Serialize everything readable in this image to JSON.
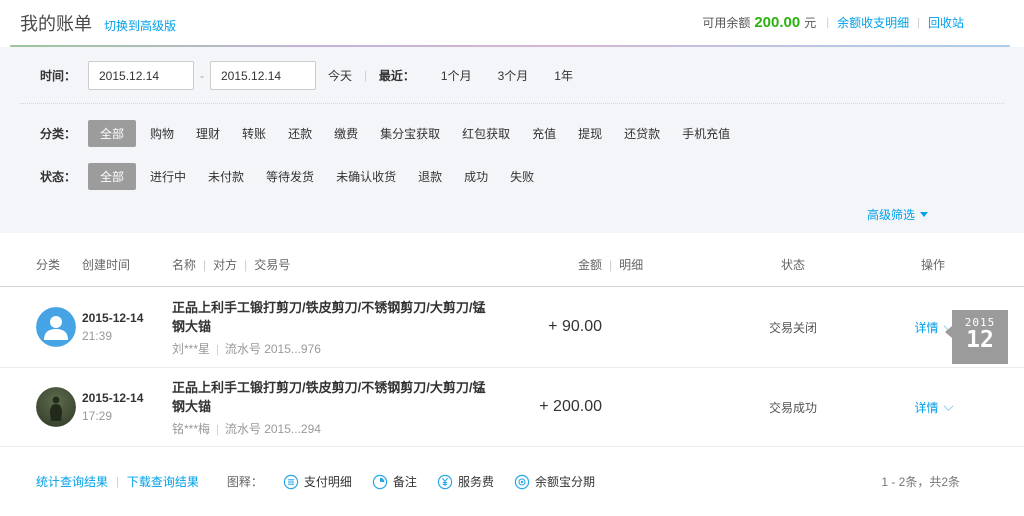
{
  "separators": {
    "pipe": "|",
    "dash": "-"
  },
  "colors": {
    "accent_blue": "#00a0e9",
    "balance_green": "#2bb20e",
    "selected_chip_bg": "#9c9c9c",
    "badge_bg": "#9b9b9b",
    "panel_bg": "#f4f5f9"
  },
  "header": {
    "title": "我的账单",
    "switch_link": "切换到高级版",
    "balance_label": "可用余额",
    "balance_value": "200.00",
    "balance_unit": "元",
    "links": [
      "余额收支明细",
      "回收站"
    ]
  },
  "filters": {
    "time": {
      "label": "时间：",
      "start": "2015.12.14",
      "end": "2015.12.14",
      "today": "今天",
      "recent_label": "最近：",
      "ranges": [
        "1个月",
        "3个月",
        "1年"
      ]
    },
    "category": {
      "label": "分类：",
      "options": [
        "全部",
        "购物",
        "理财",
        "转账",
        "还款",
        "缴费",
        "集分宝获取",
        "红包获取",
        "充值",
        "提现",
        "还贷款",
        "手机充值"
      ],
      "selected": "全部"
    },
    "status": {
      "label": "状态：",
      "options": [
        "全部",
        "进行中",
        "未付款",
        "等待发货",
        "未确认收货",
        "退款",
        "成功",
        "失败"
      ],
      "selected": "全部"
    },
    "advanced": "高级筛选",
    "advanced_icon": "chevron-down-icon"
  },
  "table": {
    "headers": {
      "category": "分类",
      "created": "创建时间",
      "name": "名称",
      "party": "对方",
      "trade_no": "交易号",
      "amount": "金额",
      "detail": "明细",
      "status": "状态",
      "action": "操作"
    },
    "rows": [
      {
        "avatar": "person-avatar-blue",
        "date": "2015-12-14",
        "time": "21:39",
        "title": "正品上利手工锻打剪刀/铁皮剪刀/不锈钢剪刀/大剪刀/锰钢大锚",
        "party": "刘***星",
        "serial": "流水号 2015...976",
        "amount": "+ 90.00",
        "status": "交易关闭",
        "action": "详情",
        "action_icon": "chevron-down-icon"
      },
      {
        "avatar": "photo-avatar-dark",
        "date": "2015-12-14",
        "time": "17:29",
        "title": "正品上利手工锻打剪刀/铁皮剪刀/不锈钢剪刀/大剪刀/锰钢大锚",
        "party": "铭***梅",
        "serial": "流水号 2015...294",
        "amount": "+ 200.00",
        "status": "交易成功",
        "action": "详情",
        "action_icon": "chevron-down-icon"
      }
    ]
  },
  "date_badge": {
    "year": "2015",
    "month": "12"
  },
  "footer": {
    "stats_link": "统计查询结果",
    "download_link": "下载查询结果",
    "legend_label": "图释：",
    "legend": [
      {
        "icon": "payment-detail-icon",
        "label": "支付明细"
      },
      {
        "icon": "note-icon",
        "label": "备注"
      },
      {
        "icon": "service-fee-icon",
        "label": "服务费"
      },
      {
        "icon": "yuebao-installment-icon",
        "label": "余额宝分期"
      }
    ],
    "result_count": "1 - 2条，共2条"
  }
}
